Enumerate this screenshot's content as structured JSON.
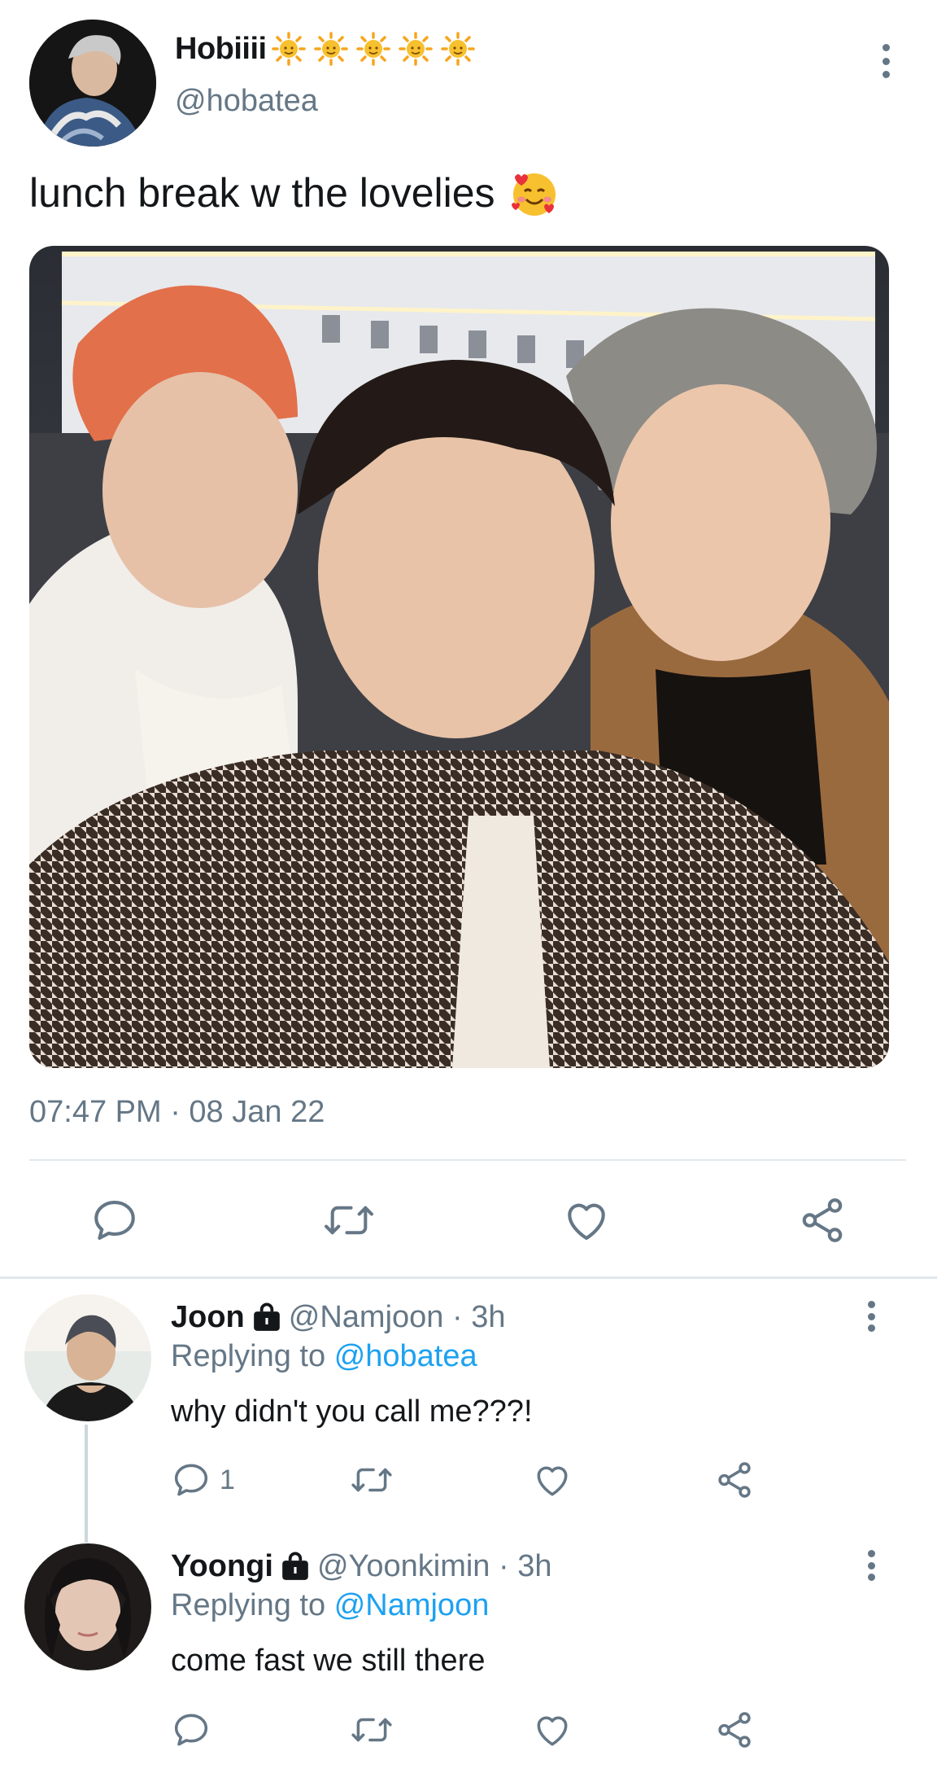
{
  "tweet": {
    "author": {
      "display_name": "Hobiiii",
      "name_emojis": [
        "sun-emoji",
        "sun-emoji",
        "sun-emoji",
        "sun-emoji",
        "sun-emoji"
      ],
      "handle": "@hobatea"
    },
    "text": "lunch break w the lovelies",
    "text_emoji": "smiling-face-with-hearts",
    "timestamp": "07:47 PM · 08 Jan 22",
    "actions": [
      "reply-icon",
      "retweet-icon",
      "like-icon",
      "share-icon"
    ]
  },
  "replies": [
    {
      "display_name": "Joon",
      "locked": true,
      "handle_time": "@Namjoon · 3h",
      "replying_prefix": "Replying to",
      "replying_to": "@hobatea",
      "text": "why didn't you call me???!",
      "reply_count": "1"
    },
    {
      "display_name": "Yoongi",
      "locked": true,
      "handle_time": "@Yoonkimin · 3h",
      "replying_prefix": "Replying to",
      "replying_to": "@Namjoon",
      "text": "come fast we still there",
      "reply_count": ""
    }
  ],
  "colors": {
    "text": "#14171a",
    "muted": "#657786",
    "link": "#1da1f2",
    "divider": "#e1e8ed"
  }
}
